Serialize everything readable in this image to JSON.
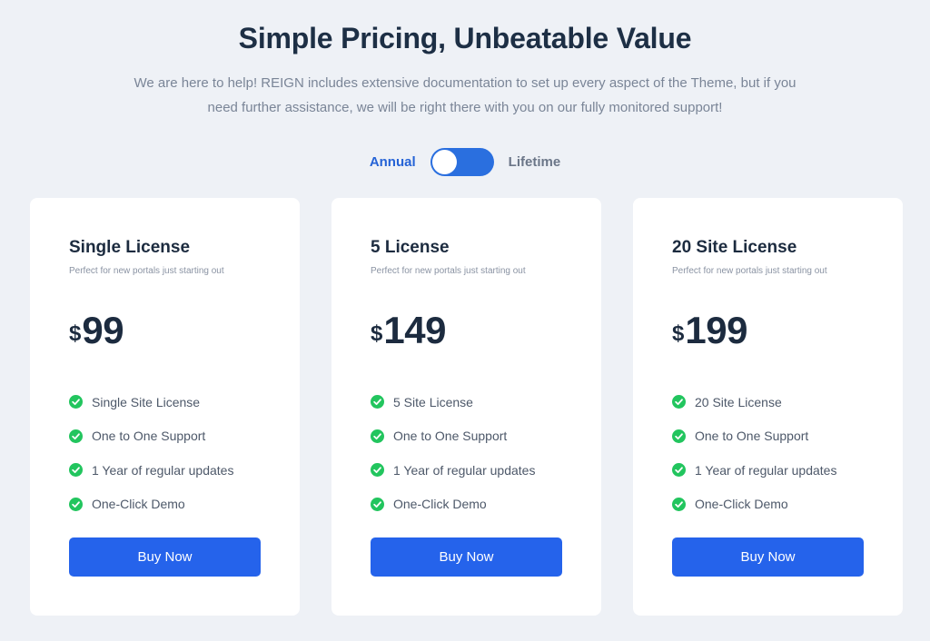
{
  "header": {
    "title": "Simple Pricing, Unbeatable Value",
    "subtitle_line1": "We are here to help! REIGN includes extensive documentation to set up every aspect of the Theme, but if you",
    "subtitle_line2": "need further assistance, we will be right there with you on our fully monitored support!"
  },
  "billing_toggle": {
    "left_label": "Annual",
    "right_label": "Lifetime",
    "active": "Annual"
  },
  "plans": [
    {
      "title": "Single License",
      "tagline": "Perfect for new portals just starting out",
      "currency": "$",
      "price": "99",
      "features": [
        "Single Site License",
        "One to One Support",
        "1 Year of regular updates",
        "One-Click Demo"
      ],
      "button_label": "Buy Now"
    },
    {
      "title": "5 License",
      "tagline": "Perfect for new portals just starting out",
      "currency": "$",
      "price": "149",
      "features": [
        "5 Site License",
        "One to One Support",
        "1 Year of regular updates",
        "One-Click Demo"
      ],
      "button_label": "Buy Now"
    },
    {
      "title": "20 Site License",
      "tagline": "Perfect for new portals just starting out",
      "currency": "$",
      "price": "199",
      "features": [
        "20 Site License",
        "One to One Support",
        "1 Year of regular updates",
        "One-Click Demo"
      ],
      "button_label": "Buy Now"
    }
  ],
  "icons": {
    "feature_check": "check-circle-icon"
  },
  "colors": {
    "accent": "#2563eb",
    "toggle": "#2a6fdf",
    "check": "#22c55e",
    "background": "#eef1f6"
  }
}
